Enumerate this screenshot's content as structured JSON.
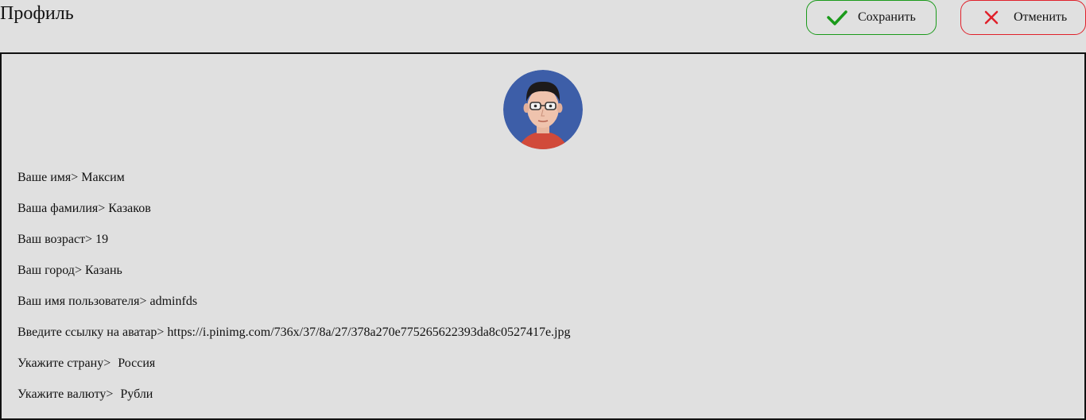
{
  "header": {
    "title": "Профиль",
    "save_label": "Сохранить",
    "cancel_label": "Отменить"
  },
  "colors": {
    "save_accent": "#1a9a1a",
    "cancel_accent": "#e0202a",
    "background": "#e0e0e0"
  },
  "profile": {
    "rows": [
      {
        "label": "Ваше имя>",
        "value": "Максим"
      },
      {
        "label": "Ваша фамилия>",
        "value": "Казаков"
      },
      {
        "label": "Ваш возраст>",
        "value": "19"
      },
      {
        "label": "Ваш город>",
        "value": "Казань"
      },
      {
        "label": "Ваш имя пользователя>",
        "value": "adminfds"
      },
      {
        "label": "Введите ссылку на аватар>",
        "value": "https://i.pinimg.com/736x/37/8a/27/378a270e775265622393da8c0527417e.jpg"
      },
      {
        "label": "Укажите страну>",
        "value": "Россия"
      },
      {
        "label": "Укажите валюту>",
        "value": "Рубли"
      }
    ]
  }
}
